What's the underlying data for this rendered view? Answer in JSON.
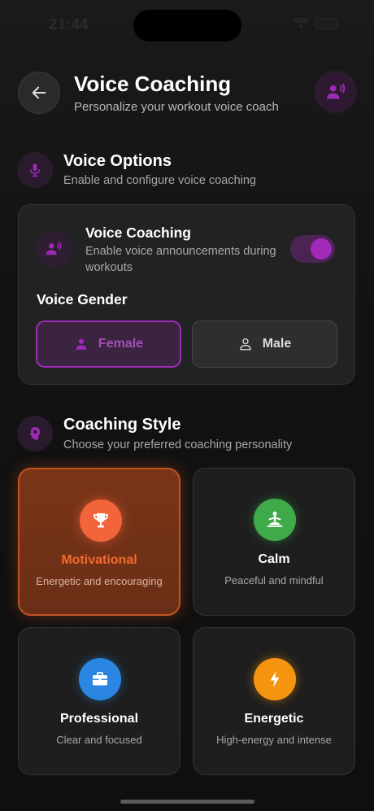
{
  "status": {
    "time": "21:44"
  },
  "header": {
    "title": "Voice Coaching",
    "subtitle": "Personalize your workout voice coach"
  },
  "voice_options": {
    "title": "Voice Options",
    "subtitle": "Enable and configure voice coaching",
    "toggle_title": "Voice Coaching",
    "toggle_desc": "Enable voice announcements during workouts",
    "toggle_on": true,
    "gender_title": "Voice Gender",
    "female_label": "Female",
    "male_label": "Male",
    "selected_gender": "Female"
  },
  "coaching_style": {
    "title": "Coaching Style",
    "subtitle": "Choose your preferred coaching personality",
    "styles": [
      {
        "name": "Motivational",
        "desc": "Energetic and encouraging",
        "icon": "trophy-icon",
        "color": "#f2643a",
        "selected": true
      },
      {
        "name": "Calm",
        "desc": "Peaceful and mindful",
        "icon": "meditation-icon",
        "color": "#3faa4a",
        "selected": false
      },
      {
        "name": "Professional",
        "desc": "Clear and focused",
        "icon": "briefcase-icon",
        "color": "#2a86e0",
        "selected": false
      },
      {
        "name": "Energetic",
        "desc": "High-energy and intense",
        "icon": "lightning-icon",
        "color": "#f5940f",
        "selected": false
      }
    ]
  },
  "colors": {
    "accent": "#a12ab8",
    "background": "#111111"
  }
}
